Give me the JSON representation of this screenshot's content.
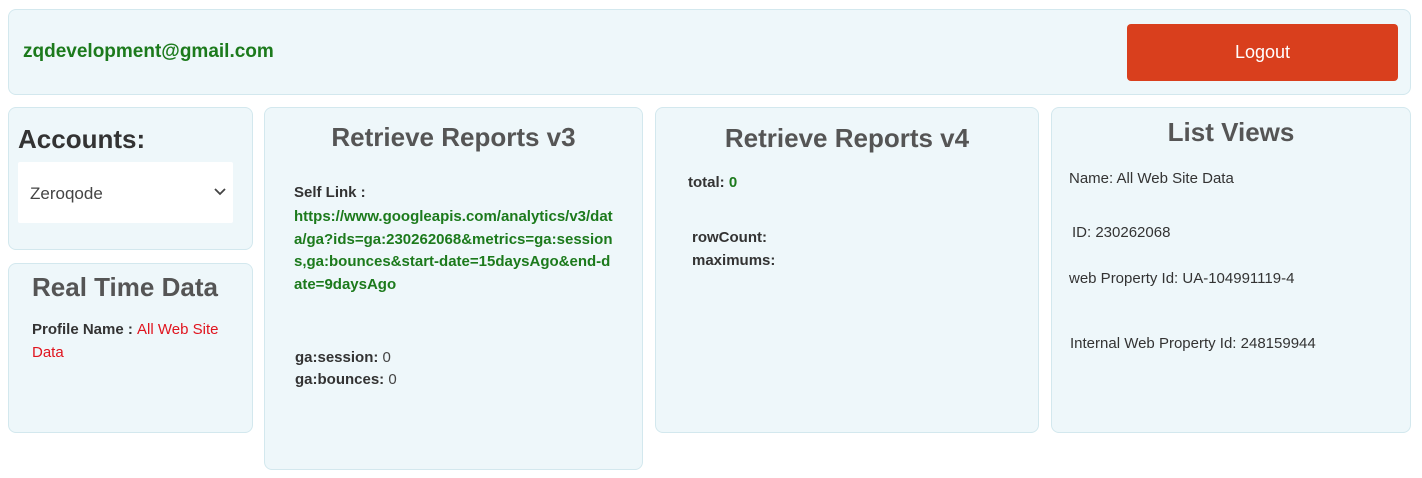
{
  "header": {
    "email": "zqdevelopment@gmail.com",
    "logout_label": "Logout"
  },
  "accounts": {
    "title": "Accounts:",
    "selected": "Zeroqode"
  },
  "realtime": {
    "title": "Real Time Data",
    "profile_label": "Profile Name : ",
    "profile_value": "All Web Site Data"
  },
  "reports_v3": {
    "title": "Retrieve Reports v3",
    "self_link_label": "Self Link :",
    "self_link_value": "https://www.googleapis.com/analytics/v3/data/ga?ids=ga:230262068&metrics=ga:sessions,ga:bounces&start-date=15daysAgo&end-date=9daysAgo",
    "session_label": "ga:session:",
    "session_value": " 0",
    "bounces_label": "ga:bounces:",
    "bounces_value": " 0"
  },
  "reports_v4": {
    "title": "Retrieve Reports v4",
    "total_label": "total:",
    "total_value": " 0",
    "rowcount_label": "rowCount:",
    "maximums_label": "maximums:"
  },
  "list_views": {
    "title": "List Views",
    "name": "Name: All Web Site Data",
    "id": "ID: 230262068",
    "web_property_id": "web Property Id: UA-104991119-4",
    "internal_web_property_id": "Internal Web Property Id: 248159944"
  },
  "colors": {
    "panel_bg": "#eef7fa",
    "logout_bg": "#d93f1d",
    "green": "#1c7a1c",
    "red": "#e0141e"
  },
  "icons": [
    "chevron-down-icon"
  ]
}
